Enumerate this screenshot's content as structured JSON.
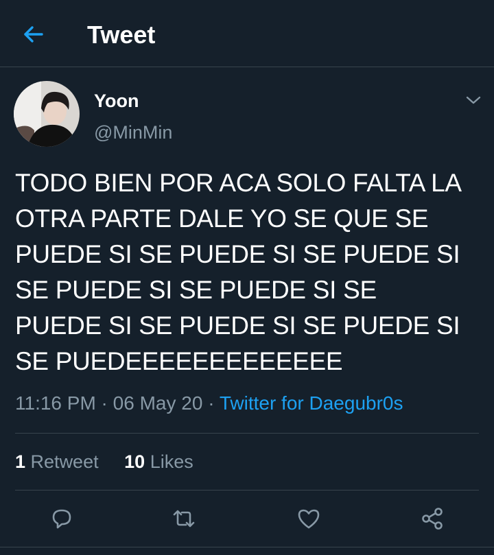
{
  "header": {
    "title": "Tweet",
    "back_icon": "back-arrow-icon",
    "accent_color": "#1da1f2"
  },
  "tweet": {
    "author": {
      "display_name": "Yoon",
      "username": "@MinMin"
    },
    "text": "TODO BIEN POR ACA SOLO FALTA LA OTRA PARTE DALE YO SE QUE SE PUEDE SI SE PUEDE SI SE PUEDE SI SE PUEDE SI SE PUEDE SI SE PUEDE SI SE PUEDE SI SE PUEDE SI SE PUEDEEEEEEEEEEEEE",
    "time": "11:16 PM",
    "separator": " · ",
    "date": "06 May 20",
    "source": "Twitter for Daegubr0s",
    "stats": {
      "retweets_count": "1",
      "retweets_label": "Retweet",
      "likes_count": "10",
      "likes_label": "Likes"
    }
  },
  "actions": [
    "reply-icon",
    "retweet-icon",
    "like-icon",
    "share-icon"
  ],
  "colors": {
    "background": "#15202b",
    "divider": "#38444d",
    "secondary_text": "#8899a6",
    "link": "#1da1f2"
  }
}
